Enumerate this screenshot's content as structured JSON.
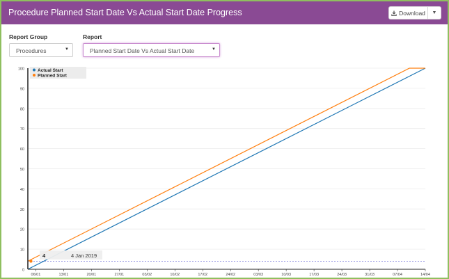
{
  "header": {
    "title": "Procedure Planned Start Date Vs Actual Start Date Progress",
    "download_label": "Download"
  },
  "filters": {
    "report_group_label": "Report Group",
    "report_group_value": "Procedures",
    "report_label": "Report",
    "report_value": "Planned Start Date Vs Actual Start Date"
  },
  "tooltip": {
    "value": "4",
    "date": "4 Jan 2019"
  },
  "colors": {
    "header": "#8a4a94",
    "actual": "#1f77b4",
    "planned": "#ff7f0e",
    "frame": "#8fbf5f"
  },
  "icons": {
    "download": "download-icon",
    "caret": "caret-down-icon",
    "select_arrow": "chevron-down-icon"
  },
  "chart_data": {
    "type": "line",
    "ylim": [
      0,
      100
    ],
    "y_ticks": [
      "0",
      "10",
      "20",
      "30",
      "40",
      "50",
      "60",
      "70",
      "80",
      "90",
      "100"
    ],
    "x_ticks": [
      "06/01",
      "13/01",
      "20/01",
      "27/01",
      "03/02",
      "10/02",
      "17/02",
      "24/02",
      "03/03",
      "10/03",
      "17/03",
      "24/03",
      "31/03",
      "07/04",
      "14/04"
    ],
    "legend_position": "top-left",
    "series": [
      {
        "name": "Actual Start",
        "x": [
          "04/01",
          "14/04"
        ],
        "y": [
          0,
          100
        ]
      },
      {
        "name": "Planned Start",
        "x": [
          "04/01",
          "10/04",
          "14/04"
        ],
        "y": [
          4,
          100,
          100
        ]
      }
    ],
    "reference_line": 4
  }
}
